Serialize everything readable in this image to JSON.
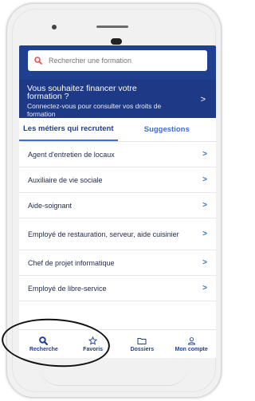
{
  "search": {
    "placeholder": "Rechercher une formation"
  },
  "finance_banner": {
    "title": "Vous souhaitez financer votre formation ?",
    "subtitle": "Connectez-vous pour consulter vos droits de formation"
  },
  "tabs": [
    {
      "label": "Les métiers qui recrutent",
      "active": true
    },
    {
      "label": "Suggestions",
      "active": false
    }
  ],
  "jobs": [
    {
      "label": "Agent d'entretien de locaux"
    },
    {
      "label": "Auxiliaire de vie sociale"
    },
    {
      "label": "Aide-soignant"
    },
    {
      "label": "Employé de restauration, serveur, aide cuisinier"
    },
    {
      "label": "Chef de projet informatique"
    },
    {
      "label": "Employé de libre-service"
    }
  ],
  "chevron": ">",
  "bottom_nav": [
    {
      "label": "Recherche",
      "icon": "search-icon"
    },
    {
      "label": "Favoris",
      "icon": "star-icon"
    },
    {
      "label": "Dossiers",
      "icon": "folder-icon"
    },
    {
      "label": "Mon compte",
      "icon": "user-icon"
    }
  ],
  "colors": {
    "primary_blue": "#1f3f8f",
    "accent_blue": "#3a6fd8",
    "search_icon_red": "#e24b3b"
  }
}
